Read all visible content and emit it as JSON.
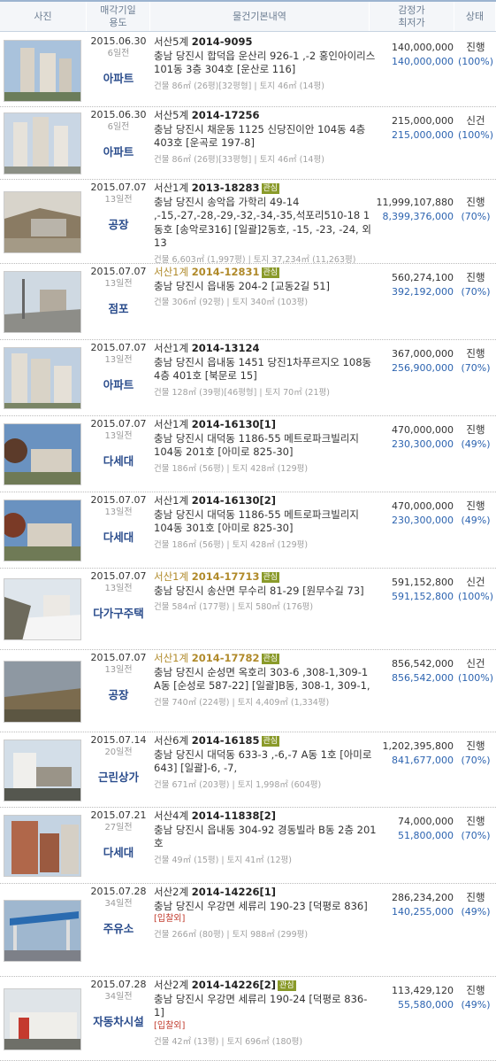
{
  "header": {
    "photo": "사진",
    "date_line1": "매각기일",
    "date_line2": "용도",
    "info": "물건기본내역",
    "price_line1": "감정가",
    "price_line2": "최저가",
    "status": "상태"
  },
  "rows": [
    {
      "date": "2015.06.30",
      "days": "6일전",
      "usage": "아파트",
      "court": "서산5계",
      "num": "2014-9095",
      "tag": "",
      "addr": "충남 당진시 합덕읍 운산리 926-1 ,-2 홍인아이리스 101동 3층 304호 [운산로 116]",
      "bid": "",
      "sub": "건물 86㎡ (26평)[32평형] | 토지 46㎡ (14평)",
      "p1": "140,000,000",
      "p2": "140,000,000",
      "status": "진행",
      "pct": "(100%)"
    },
    {
      "date": "2015.06.30",
      "days": "6일전",
      "usage": "아파트",
      "court": "서산5계",
      "num": "2014-17256",
      "tag": "",
      "addr": "충남 당진시 채운동 1125 신당진이안 104동 4층 403호 [운곡로 197-8]",
      "bid": "",
      "sub": "건물 86㎡ (26평)[33평형] | 토지 46㎡ (14평)",
      "p1": "215,000,000",
      "p2": "215,000,000",
      "status": "신건",
      "pct": "(100%)"
    },
    {
      "date": "2015.07.07",
      "days": "13일전",
      "usage": "공장",
      "court": "서산1계",
      "num": "2013-18283",
      "tag": "관심",
      "addr": "충남 당진시 송악읍 가학리 49-14 ,-15,-27,-28,-29,-32,-34,-35,석포리510-18 1동호 [송악로316] [일괄]2동호, -15, -23, -24, 외13",
      "bid": "",
      "sub": "건물 6,603㎡ (1,997평) | 토지 37,234㎡ (11,263평)",
      "p1": "11,999,107,880",
      "p2": "8,399,376,000",
      "status": "진행",
      "pct": "(70%)"
    },
    {
      "date": "2015.07.07",
      "days": "13일전",
      "usage": "점포",
      "court": "서산1계",
      "num": "2014-12831",
      "tag": "관심",
      "hl": true,
      "addr": "충남 당진시 읍내동 204-2 [교동2길 51]",
      "bid": "",
      "sub": "건물 306㎡ (92평) | 토지 340㎡ (103평)",
      "p1": "560,274,100",
      "p2": "392,192,000",
      "status": "진행",
      "pct": "(70%)"
    },
    {
      "date": "2015.07.07",
      "days": "13일전",
      "usage": "아파트",
      "court": "서산1계",
      "num": "2014-13124",
      "tag": "",
      "addr": "충남 당진시 읍내동 1451 당진1차푸르지오 108동 4층 401호 [북문로 15]",
      "bid": "",
      "sub": "건물 128㎡ (39평)[46평형] | 토지 70㎡ (21평)",
      "p1": "367,000,000",
      "p2": "256,900,000",
      "status": "진행",
      "pct": "(70%)"
    },
    {
      "date": "2015.07.07",
      "days": "13일전",
      "usage": "다세대",
      "court": "서산1계",
      "num": "2014-16130[1]",
      "tag": "",
      "addr": "충남 당진시 대덕동 1186-55 메트로파크빌리지 104동 201호 [아미로 825-30]",
      "bid": "",
      "sub": "건물 186㎡ (56평) | 토지 428㎡ (129평)",
      "p1": "470,000,000",
      "p2": "230,300,000",
      "status": "진행",
      "pct": "(49%)"
    },
    {
      "date": "2015.07.07",
      "days": "13일전",
      "usage": "다세대",
      "court": "서산1계",
      "num": "2014-16130[2]",
      "tag": "",
      "addr": "충남 당진시 대덕동 1186-55 메트로파크빌리지 104동 301호 [아미로 825-30]",
      "bid": "",
      "sub": "건물 186㎡ (56평) | 토지 428㎡ (129평)",
      "p1": "470,000,000",
      "p2": "230,300,000",
      "status": "진행",
      "pct": "(49%)"
    },
    {
      "date": "2015.07.07",
      "days": "13일전",
      "usage": "다가구주택",
      "court": "서산1계",
      "num": "2014-17713",
      "tag": "관심",
      "hl": true,
      "addr": "충남 당진시 송산면 무수리 81-29 [원무수길 73]",
      "bid": "",
      "sub": "건물 584㎡ (177평) | 토지 580㎡ (176평)",
      "p1": "591,152,800",
      "p2": "591,152,800",
      "status": "신건",
      "pct": "(100%)"
    },
    {
      "date": "2015.07.07",
      "days": "13일전",
      "usage": "공장",
      "court": "서산1계",
      "num": "2014-17782",
      "tag": "관심",
      "hl": true,
      "addr": "충남 당진시 순성면 옥호리 303-6 ,308-1,309-1 A동 [순성로 587-22] [일괄]B동, 308-1, 309-1,",
      "bid": "",
      "sub": "건물 740㎡ (224평) | 토지 4,409㎡ (1,334평)",
      "p1": "856,542,000",
      "p2": "856,542,000",
      "status": "신건",
      "pct": "(100%)"
    },
    {
      "date": "2015.07.14",
      "days": "20일전",
      "usage": "근린상가",
      "court": "서산6계",
      "num": "2014-16185",
      "tag": "관심",
      "addr": "충남 당진시 대덕동 633-3 ,-6,-7 A동 1호 [아미로 643] [일괄]-6, -7,",
      "bid": "",
      "sub": "건물 671㎡ (203평) | 토지 1,998㎡ (604평)",
      "p1": "1,202,395,800",
      "p2": "841,677,000",
      "status": "진행",
      "pct": "(70%)"
    },
    {
      "date": "2015.07.21",
      "days": "27일전",
      "usage": "다세대",
      "court": "서산4계",
      "num": "2014-11838[2]",
      "tag": "",
      "addr": "충남 당진시 읍내동 304-92 경동빌라 B동 2층 201호",
      "bid": "",
      "sub": "건물 49㎡ (15평) | 토지 41㎡ (12평)",
      "p1": "74,000,000",
      "p2": "51,800,000",
      "status": "진행",
      "pct": "(70%)"
    },
    {
      "date": "2015.07.28",
      "days": "34일전",
      "usage": "주유소",
      "court": "서산2계",
      "num": "2014-14226[1]",
      "tag": "",
      "addr": "충남 당진시 우강면 세류리 190-23 [덕평로 836]",
      "bid": "[입찰외]",
      "sub": "건물 266㎡ (80평) | 토지 988㎡ (299평)",
      "p1": "286,234,200",
      "p2": "140,255,000",
      "status": "진행",
      "pct": "(49%)"
    },
    {
      "date": "2015.07.28",
      "days": "34일전",
      "usage": "자동차시설",
      "court": "서산2계",
      "num": "2014-14226[2]",
      "tag": "관심",
      "addr": "충남 당진시 우강면 세류리 190-24 [덕평로 836-1]",
      "bid": "[입찰외]",
      "sub": "건물 42㎡ (13평) | 토지 696㎡ (180평)",
      "p1": "113,429,120",
      "p2": "55,580,000",
      "status": "진행",
      "pct": "(49%)"
    }
  ]
}
